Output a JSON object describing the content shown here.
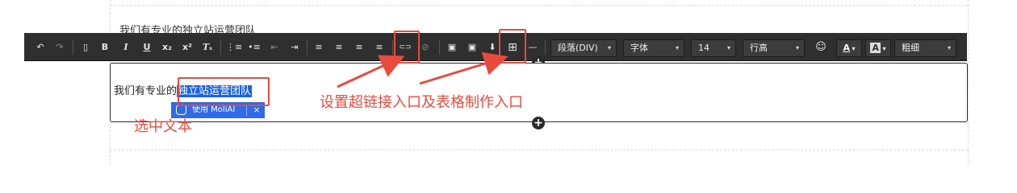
{
  "faded_text": "我们有专业的独立站运营团队",
  "toolbar": {
    "buttons": [
      {
        "name": "undo-icon",
        "glyph": "↶"
      },
      {
        "name": "redo-icon",
        "glyph": "↷"
      },
      {
        "name": "source-doc-icon",
        "glyph": "▯"
      },
      {
        "name": "bold-button",
        "glyph": "B"
      },
      {
        "name": "italic-button",
        "glyph": "I"
      },
      {
        "name": "underline-button",
        "glyph": "U"
      },
      {
        "name": "subscript-button",
        "glyph": "x₂"
      },
      {
        "name": "superscript-button",
        "glyph": "x²"
      },
      {
        "name": "clear-format-button",
        "glyph": "Tₓ"
      },
      {
        "name": "ordered-list-icon",
        "glyph": "⋮≡"
      },
      {
        "name": "unordered-list-icon",
        "glyph": "•≡"
      },
      {
        "name": "outdent-icon",
        "glyph": "⇤"
      },
      {
        "name": "indent-icon",
        "glyph": "⇥"
      },
      {
        "name": "align-left-icon",
        "glyph": "≡"
      },
      {
        "name": "align-center-icon",
        "glyph": "≡"
      },
      {
        "name": "align-right-icon",
        "glyph": "≡"
      },
      {
        "name": "align-justify-icon",
        "glyph": "≡"
      },
      {
        "name": "link-icon",
        "glyph": "⊂⊃"
      },
      {
        "name": "unlink-icon",
        "glyph": "⊘"
      },
      {
        "name": "image-icon",
        "glyph": "▣"
      },
      {
        "name": "image-upload-icon",
        "glyph": "▣"
      },
      {
        "name": "insert-below-icon",
        "glyph": "⬇"
      },
      {
        "name": "table-icon",
        "glyph": "⊞"
      },
      {
        "name": "horizontal-rule-icon",
        "glyph": "—"
      },
      {
        "name": "emoji-icon",
        "glyph": "☺"
      }
    ],
    "paragraph_select": "段落(DIV)",
    "font_select": "字体",
    "size_select": "14",
    "line_height_select": "行高",
    "font_color_label": "A",
    "bg_color_label": "A",
    "weight_select": "粗细"
  },
  "editor": {
    "text_before": "我们有专业的",
    "selected_text": "独立站运营团队"
  },
  "moli_popup": {
    "label": "使用 MoliAI",
    "close": "×"
  },
  "annotations": {
    "toolbar_note": "设置超链接入口及表格制作入口",
    "selection_note": "选中文本"
  },
  "colors": {
    "toolbar_bg": "#2f2f2f",
    "selection_blue": "#1b62e0",
    "annotation_red": "#e84a3c"
  }
}
